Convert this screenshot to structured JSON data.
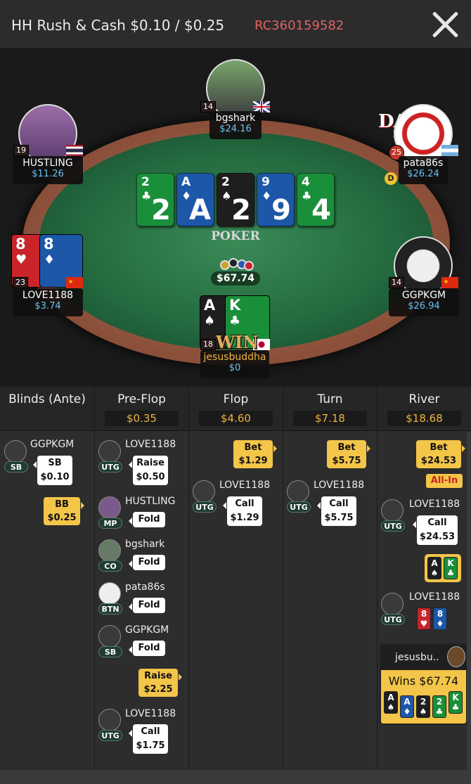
{
  "header": {
    "title": "HH  Rush & Cash $0.10 / $0.25",
    "hand_id": "RC360159582",
    "close_icon": "close-icon"
  },
  "table": {
    "logo": {
      "brand": "DAVAO",
      "sub": "POKER"
    },
    "felt_text": "POKER",
    "board": [
      {
        "rank": "2",
        "suit": "♣",
        "color": "#1a8f3a"
      },
      {
        "rank": "A",
        "suit": "♦",
        "color": "#1d57a8"
      },
      {
        "rank": "2",
        "suit": "♠",
        "color": "#1e1e1e"
      },
      {
        "rank": "9",
        "suit": "♦",
        "color": "#1d57a8"
      },
      {
        "rank": "4",
        "suit": "♣",
        "color": "#1a8f3a"
      }
    ],
    "pot": "$67.74",
    "win_label": "WIN",
    "seats": [
      {
        "name": "bgshark",
        "stack": "$24.16",
        "level": "14",
        "flag": "uk-flag"
      },
      {
        "name": "HUSTLING",
        "stack": "$11.26",
        "level": "19",
        "flag": "thai-flag"
      },
      {
        "name": "pata86s",
        "stack": "$26.24",
        "level": "25",
        "flag": "argentina-flag",
        "dealer": "D"
      },
      {
        "name": "LOVE1188",
        "stack": "$3.74",
        "level": "23",
        "flag": "china-flag",
        "cards": [
          {
            "rank": "8",
            "suit": "♥",
            "color": "#c8242a"
          },
          {
            "rank": "8",
            "suit": "♦",
            "color": "#1d57a8"
          }
        ]
      },
      {
        "name": "GGPKGM",
        "stack": "$26.94",
        "level": "14",
        "flag": "china-flag"
      },
      {
        "name": "jesusbuddha",
        "stack": "$0",
        "level": "18",
        "flag": "japan-flag",
        "cards": [
          {
            "rank": "A",
            "suit": "♠",
            "color": "#1e1e1e"
          },
          {
            "rank": "K",
            "suit": "♣",
            "color": "#1a8f3a"
          }
        ]
      }
    ]
  },
  "history": {
    "columns": [
      {
        "title": "Blinds (Ante)",
        "pot": ""
      },
      {
        "title": "Pre-Flop",
        "pot": "$0.35"
      },
      {
        "title": "Flop",
        "pot": "$4.60"
      },
      {
        "title": "Turn",
        "pot": "$7.18"
      },
      {
        "title": "River",
        "pot": "$18.68"
      }
    ],
    "blinds": {
      "player": "GGPKGM",
      "pos": "SB",
      "action": "SB",
      "amount": "$0.10",
      "bb_action": "BB",
      "bb_amount": "$0.25"
    },
    "preflop": [
      {
        "player": "LOVE1188",
        "pos": "UTG",
        "action": "Raise",
        "amount": "$0.50"
      },
      {
        "player": "HUSTLING",
        "pos": "MP",
        "action": "Fold"
      },
      {
        "player": "bgshark",
        "pos": "CO",
        "action": "Fold"
      },
      {
        "player": "pata86s",
        "pos": "BTN",
        "action": "Fold"
      },
      {
        "player": "GGPKGM",
        "pos": "SB",
        "action": "Fold"
      },
      {
        "hero_action": "Raise",
        "hero_amount": "$2.25"
      },
      {
        "player": "LOVE1188",
        "pos": "UTG",
        "action": "Call",
        "amount": "$1.75"
      }
    ],
    "flop": {
      "hero_action": "Bet",
      "hero_amount": "$1.29",
      "player": "LOVE1188",
      "pos": "UTG",
      "action": "Call",
      "amount": "$1.29"
    },
    "turn": {
      "hero_action": "Bet",
      "hero_amount": "$5.75",
      "player": "LOVE1188",
      "pos": "UTG",
      "action": "Call",
      "amount": "$5.75"
    },
    "river": {
      "hero_action": "Bet",
      "hero_amount": "$24.53",
      "allin": "All-In",
      "player": "LOVE1188",
      "pos": "UTG",
      "action": "Call",
      "amount": "$24.53",
      "hero_cards": [
        {
          "rank": "A",
          "suit": "♠",
          "color": "#1e1e1e"
        },
        {
          "rank": "K",
          "suit": "♣",
          "color": "#1a8f3a"
        }
      ],
      "show_player": "LOVE1188",
      "show_pos": "UTG",
      "show_cards": [
        {
          "rank": "8",
          "suit": "♥",
          "color": "#c8242a"
        },
        {
          "rank": "8",
          "suit": "♦",
          "color": "#1d57a8"
        }
      ],
      "winner": "jesusbu..",
      "win_text": "Wins $67.74",
      "win_cards": [
        {
          "rank": "A",
          "suit": "♠",
          "color": "#1e1e1e"
        },
        {
          "rank": "A",
          "suit": "♦",
          "color": "#1d57a8"
        },
        {
          "rank": "2",
          "suit": "♠",
          "color": "#1e1e1e"
        },
        {
          "rank": "2",
          "suit": "♣",
          "color": "#1a8f3a"
        },
        {
          "rank": "K",
          "suit": "♣",
          "color": "#1a8f3a"
        }
      ]
    }
  }
}
